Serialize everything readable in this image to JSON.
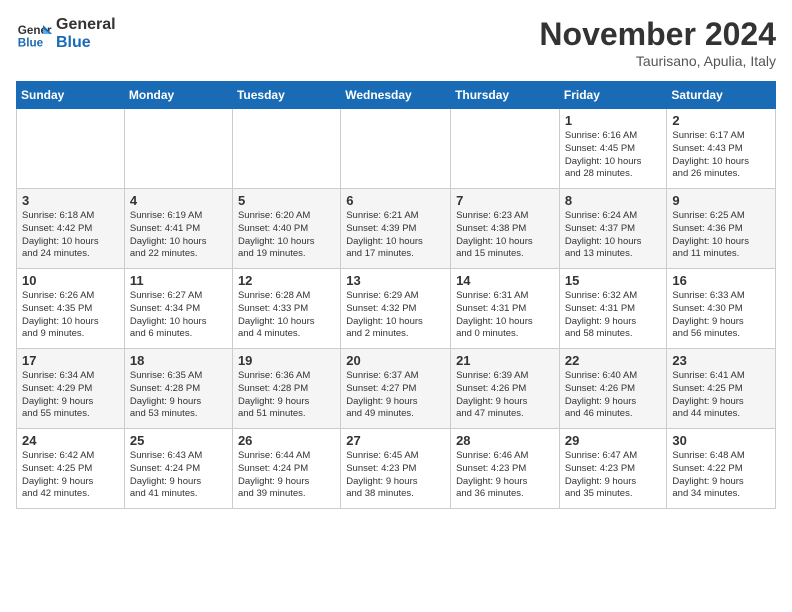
{
  "logo": {
    "line1": "General",
    "line2": "Blue"
  },
  "title": "November 2024",
  "subtitle": "Taurisano, Apulia, Italy",
  "days_header": [
    "Sunday",
    "Monday",
    "Tuesday",
    "Wednesday",
    "Thursday",
    "Friday",
    "Saturday"
  ],
  "weeks": [
    [
      {
        "day": "",
        "info": ""
      },
      {
        "day": "",
        "info": ""
      },
      {
        "day": "",
        "info": ""
      },
      {
        "day": "",
        "info": ""
      },
      {
        "day": "",
        "info": ""
      },
      {
        "day": "1",
        "info": "Sunrise: 6:16 AM\nSunset: 4:45 PM\nDaylight: 10 hours\nand 28 minutes."
      },
      {
        "day": "2",
        "info": "Sunrise: 6:17 AM\nSunset: 4:43 PM\nDaylight: 10 hours\nand 26 minutes."
      }
    ],
    [
      {
        "day": "3",
        "info": "Sunrise: 6:18 AM\nSunset: 4:42 PM\nDaylight: 10 hours\nand 24 minutes."
      },
      {
        "day": "4",
        "info": "Sunrise: 6:19 AM\nSunset: 4:41 PM\nDaylight: 10 hours\nand 22 minutes."
      },
      {
        "day": "5",
        "info": "Sunrise: 6:20 AM\nSunset: 4:40 PM\nDaylight: 10 hours\nand 19 minutes."
      },
      {
        "day": "6",
        "info": "Sunrise: 6:21 AM\nSunset: 4:39 PM\nDaylight: 10 hours\nand 17 minutes."
      },
      {
        "day": "7",
        "info": "Sunrise: 6:23 AM\nSunset: 4:38 PM\nDaylight: 10 hours\nand 15 minutes."
      },
      {
        "day": "8",
        "info": "Sunrise: 6:24 AM\nSunset: 4:37 PM\nDaylight: 10 hours\nand 13 minutes."
      },
      {
        "day": "9",
        "info": "Sunrise: 6:25 AM\nSunset: 4:36 PM\nDaylight: 10 hours\nand 11 minutes."
      }
    ],
    [
      {
        "day": "10",
        "info": "Sunrise: 6:26 AM\nSunset: 4:35 PM\nDaylight: 10 hours\nand 9 minutes."
      },
      {
        "day": "11",
        "info": "Sunrise: 6:27 AM\nSunset: 4:34 PM\nDaylight: 10 hours\nand 6 minutes."
      },
      {
        "day": "12",
        "info": "Sunrise: 6:28 AM\nSunset: 4:33 PM\nDaylight: 10 hours\nand 4 minutes."
      },
      {
        "day": "13",
        "info": "Sunrise: 6:29 AM\nSunset: 4:32 PM\nDaylight: 10 hours\nand 2 minutes."
      },
      {
        "day": "14",
        "info": "Sunrise: 6:31 AM\nSunset: 4:31 PM\nDaylight: 10 hours\nand 0 minutes."
      },
      {
        "day": "15",
        "info": "Sunrise: 6:32 AM\nSunset: 4:31 PM\nDaylight: 9 hours\nand 58 minutes."
      },
      {
        "day": "16",
        "info": "Sunrise: 6:33 AM\nSunset: 4:30 PM\nDaylight: 9 hours\nand 56 minutes."
      }
    ],
    [
      {
        "day": "17",
        "info": "Sunrise: 6:34 AM\nSunset: 4:29 PM\nDaylight: 9 hours\nand 55 minutes."
      },
      {
        "day": "18",
        "info": "Sunrise: 6:35 AM\nSunset: 4:28 PM\nDaylight: 9 hours\nand 53 minutes."
      },
      {
        "day": "19",
        "info": "Sunrise: 6:36 AM\nSunset: 4:28 PM\nDaylight: 9 hours\nand 51 minutes."
      },
      {
        "day": "20",
        "info": "Sunrise: 6:37 AM\nSunset: 4:27 PM\nDaylight: 9 hours\nand 49 minutes."
      },
      {
        "day": "21",
        "info": "Sunrise: 6:39 AM\nSunset: 4:26 PM\nDaylight: 9 hours\nand 47 minutes."
      },
      {
        "day": "22",
        "info": "Sunrise: 6:40 AM\nSunset: 4:26 PM\nDaylight: 9 hours\nand 46 minutes."
      },
      {
        "day": "23",
        "info": "Sunrise: 6:41 AM\nSunset: 4:25 PM\nDaylight: 9 hours\nand 44 minutes."
      }
    ],
    [
      {
        "day": "24",
        "info": "Sunrise: 6:42 AM\nSunset: 4:25 PM\nDaylight: 9 hours\nand 42 minutes."
      },
      {
        "day": "25",
        "info": "Sunrise: 6:43 AM\nSunset: 4:24 PM\nDaylight: 9 hours\nand 41 minutes."
      },
      {
        "day": "26",
        "info": "Sunrise: 6:44 AM\nSunset: 4:24 PM\nDaylight: 9 hours\nand 39 minutes."
      },
      {
        "day": "27",
        "info": "Sunrise: 6:45 AM\nSunset: 4:23 PM\nDaylight: 9 hours\nand 38 minutes."
      },
      {
        "day": "28",
        "info": "Sunrise: 6:46 AM\nSunset: 4:23 PM\nDaylight: 9 hours\nand 36 minutes."
      },
      {
        "day": "29",
        "info": "Sunrise: 6:47 AM\nSunset: 4:23 PM\nDaylight: 9 hours\nand 35 minutes."
      },
      {
        "day": "30",
        "info": "Sunrise: 6:48 AM\nSunset: 4:22 PM\nDaylight: 9 hours\nand 34 minutes."
      }
    ]
  ]
}
